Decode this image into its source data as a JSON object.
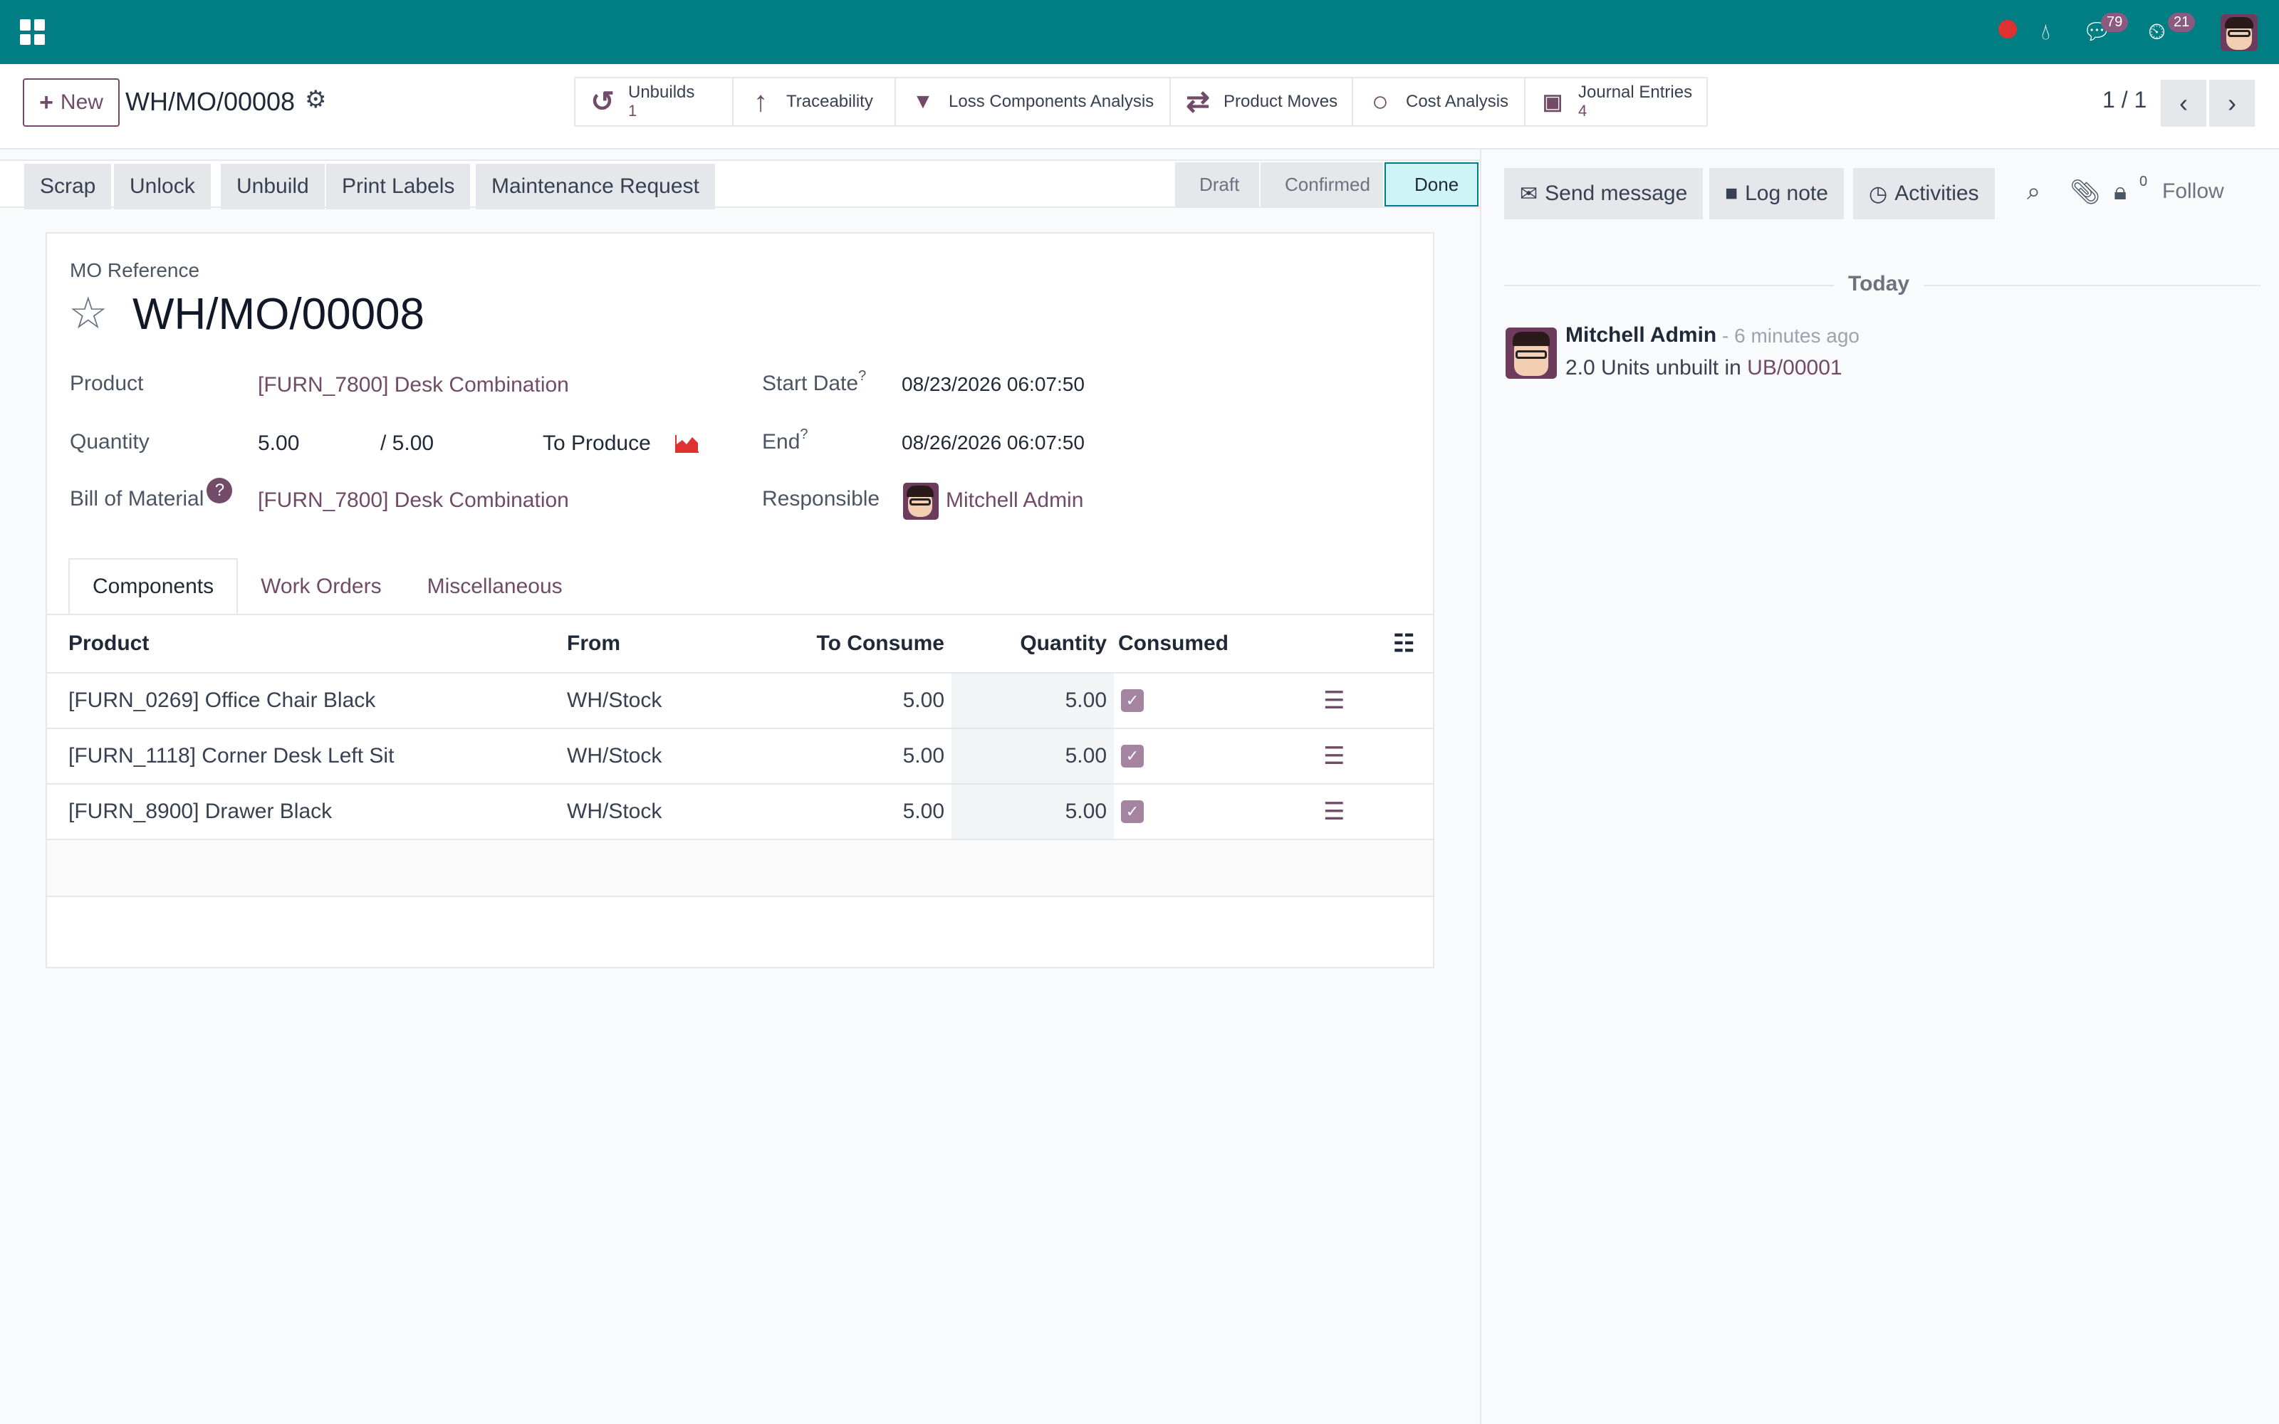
{
  "topbar": {
    "messages_count": "79",
    "activities_count": "21"
  },
  "control": {
    "new_label": "New",
    "record_name": "WH/MO/00008",
    "smart_buttons": [
      {
        "label": "Unbuilds",
        "count": "1",
        "icon": "undo-icon"
      },
      {
        "label": "Traceability",
        "count": "",
        "icon": "arrow-up-icon"
      },
      {
        "label": "Loss Components Analysis",
        "count": "",
        "icon": "drop-icon"
      },
      {
        "label": "Product Moves",
        "count": "",
        "icon": "exchange-icon"
      },
      {
        "label": "Cost Analysis",
        "count": "",
        "icon": "circle-icon"
      },
      {
        "label": "Journal Entries",
        "count": "4",
        "icon": "money-icon"
      }
    ],
    "pager": "1 / 1"
  },
  "actions": [
    "Scrap",
    "Unlock",
    "Unbuild",
    "Print Labels",
    "Maintenance Request"
  ],
  "status": {
    "draft": "Draft",
    "confirmed": "Confirmed",
    "done": "Done"
  },
  "form": {
    "ref_label": "MO Reference",
    "ref_value": "WH/MO/00008",
    "product_label": "Product",
    "product_value": "[FURN_7800] Desk Combination",
    "quantity_label": "Quantity",
    "quantity_value": "5.00",
    "quantity_total": "/ 5.00",
    "to_produce": "To Produce",
    "bom_label": "Bill of Material",
    "bom_value": "[FURN_7800] Desk Combination",
    "start_label": "Start Date",
    "start_value": "08/23/2026 06:07:50",
    "end_label": "End",
    "end_value": "08/26/2026 06:07:50",
    "responsible_label": "Responsible",
    "responsible_value": "Mitchell Admin",
    "help_marker": "?"
  },
  "tabs": [
    "Components",
    "Work Orders",
    "Miscellaneous"
  ],
  "components": {
    "headers": {
      "product": "Product",
      "from": "From",
      "to_consume": "To Consume",
      "quantity": "Quantity",
      "consumed": "Consumed"
    },
    "rows": [
      {
        "product": "[FURN_0269] Office Chair Black",
        "from": "WH/Stock",
        "to_consume": "5.00",
        "quantity": "5.00"
      },
      {
        "product": "[FURN_1118] Corner Desk Left Sit",
        "from": "WH/Stock",
        "to_consume": "5.00",
        "quantity": "5.00"
      },
      {
        "product": "[FURN_8900] Drawer Black",
        "from": "WH/Stock",
        "to_consume": "5.00",
        "quantity": "5.00"
      }
    ]
  },
  "chatter": {
    "send_message": "Send message",
    "log_note": "Log note",
    "activities": "Activities",
    "followers_count": "0",
    "follow": "Follow",
    "today": "Today",
    "author": "Mitchell Admin",
    "time": "- 6 minutes ago",
    "body": "2.0 Units unbuilt in",
    "body_link": "UB/00001"
  }
}
